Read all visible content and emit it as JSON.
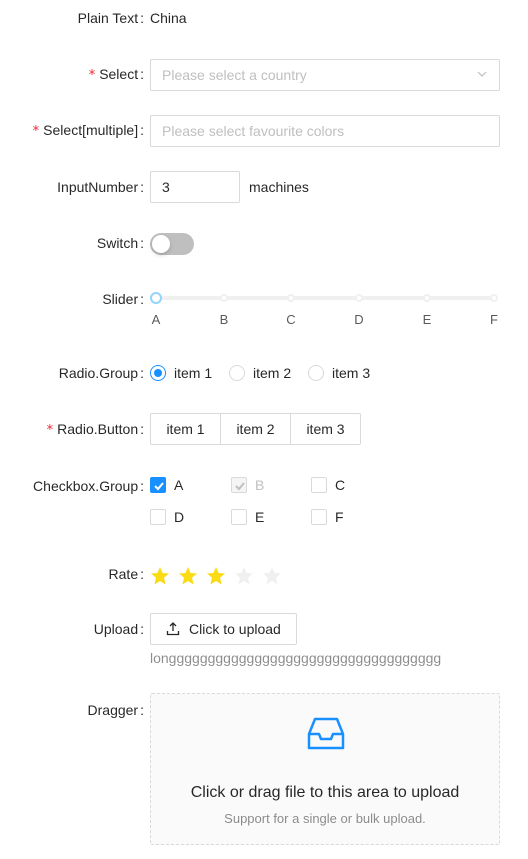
{
  "colors": {
    "primary": "#1890ff",
    "required": "#f5222d",
    "star": "#fadb14",
    "star_off": "#f0f0f0"
  },
  "plain_text": {
    "label": "Plain Text",
    "value": "China"
  },
  "select": {
    "label": "Select",
    "placeholder": "Please select a country",
    "icon": "chevron-down-icon"
  },
  "select_multiple": {
    "label": "Select[multiple]",
    "placeholder": "Please select favourite colors"
  },
  "input_number": {
    "label": "InputNumber",
    "value": "3",
    "suffix": "machines"
  },
  "switch": {
    "label": "Switch",
    "checked": false
  },
  "slider": {
    "label": "Slider",
    "marks": [
      "A",
      "B",
      "C",
      "D",
      "E",
      "F"
    ],
    "value": 0
  },
  "radio_group": {
    "label": "Radio.Group",
    "items": [
      "item 1",
      "item 2",
      "item 3"
    ],
    "selected": 0
  },
  "radio_button": {
    "label": "Radio.Button",
    "items": [
      "item 1",
      "item 2",
      "item 3"
    ]
  },
  "checkbox_group": {
    "label": "Checkbox.Group",
    "items": [
      {
        "label": "A",
        "checked": true,
        "disabled": false
      },
      {
        "label": "B",
        "checked": true,
        "disabled": true
      },
      {
        "label": "C",
        "checked": false,
        "disabled": false
      },
      {
        "label": "D",
        "checked": false,
        "disabled": false
      },
      {
        "label": "E",
        "checked": false,
        "disabled": false
      },
      {
        "label": "F",
        "checked": false,
        "disabled": false
      }
    ]
  },
  "rate": {
    "label": "Rate",
    "value": 3,
    "max": 5
  },
  "upload": {
    "label": "Upload",
    "button": "Click to upload",
    "icon": "upload-icon",
    "filename": "longgggggggggggggggggggggggggggggggggg"
  },
  "dragger": {
    "label": "Dragger",
    "text": "Click or drag file to this area to upload",
    "hint": "Support for a single or bulk upload.",
    "icon": "inbox-icon"
  }
}
